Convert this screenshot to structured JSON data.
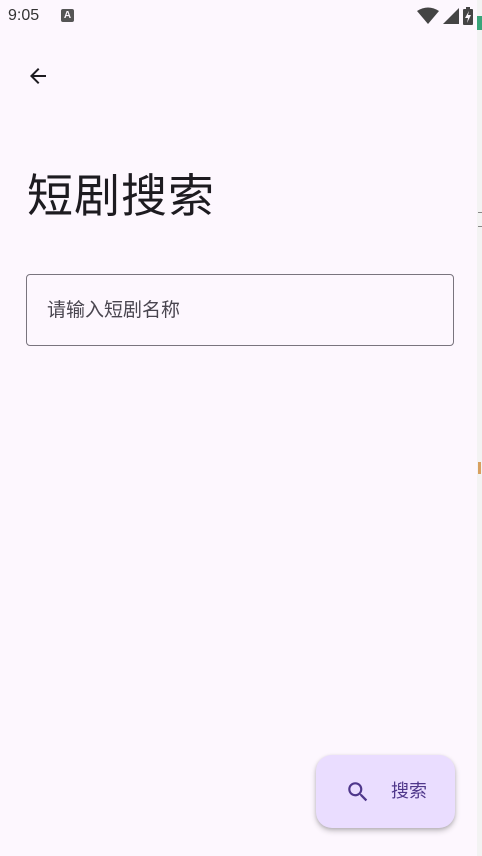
{
  "status_bar": {
    "time": "9:05",
    "notification_icon": "A"
  },
  "nav": {
    "back_icon": "arrow-back-icon"
  },
  "page": {
    "title": "短剧搜索"
  },
  "search": {
    "placeholder": "请输入短剧名称",
    "value": ""
  },
  "fab": {
    "icon": "search-icon",
    "label": "搜索"
  },
  "colors": {
    "background": "#fdf7fe",
    "fab_bg": "#eaddff",
    "fab_fg": "#4f378b",
    "text_primary": "#1d1b20",
    "outline": "#79747e"
  }
}
